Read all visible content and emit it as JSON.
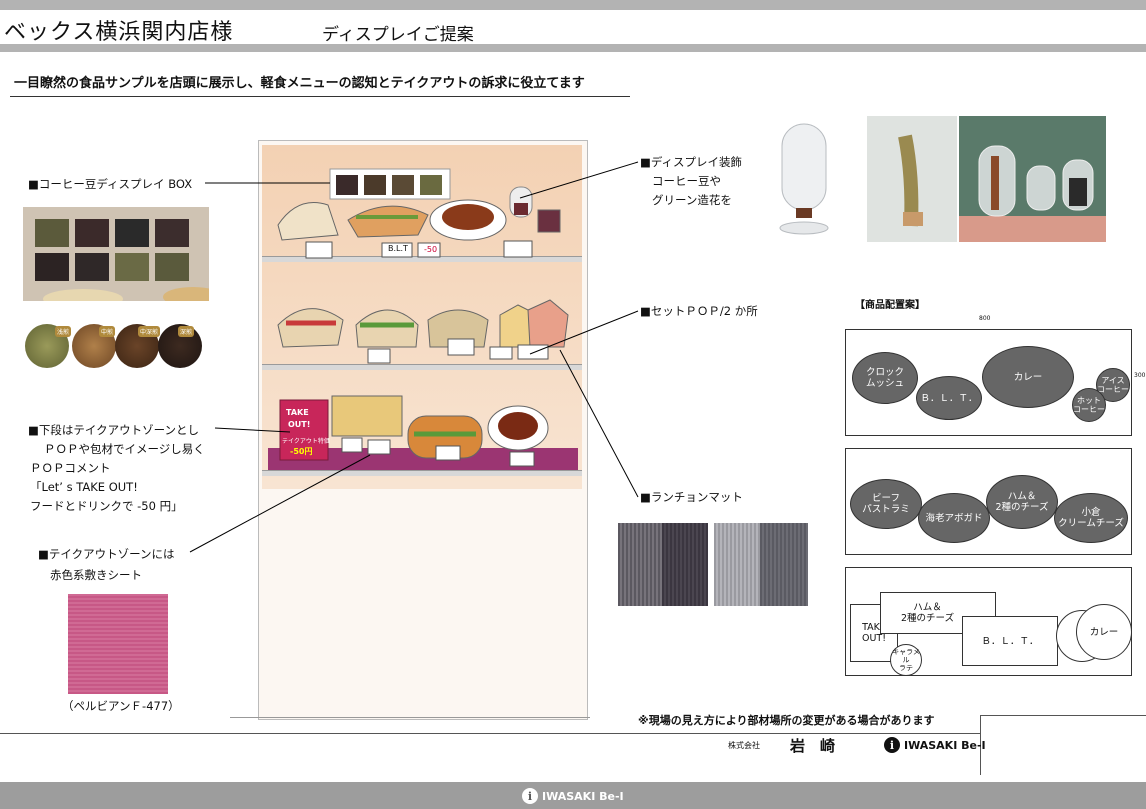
{
  "header": {
    "title": "ベックス横浜関内店様",
    "subtitle": "ディスプレイご提案"
  },
  "headline": "一目瞭然の食品サンプルを店頭に展示し、軽食メニューの認知とテイクアウトの訴求に役立てます",
  "left_labels": {
    "coffee_box": "■コーヒー豆ディスプレイ BOX",
    "lower_1": "■下段はテイクアウトゾーンとし",
    "lower_2": "ＰＯＰや包材でイメージし易く",
    "lower_3": "ＰＯＰコメント",
    "lower_4": "「Let’ s TAKE OUT!",
    "lower_5": "フードとドリンクで -50 円」",
    "zone_1": "■テイクアウトゾーンには",
    "zone_2": "赤色系敷きシート",
    "swatch_caption": "（ペルビアンＦ-477）"
  },
  "bean_badges": [
    "浅煎",
    "中煎",
    "中深煎",
    "深煎"
  ],
  "right_labels": {
    "deco_1": "■ディスプレイ装飾",
    "deco_2": "コーヒー豆や",
    "deco_3": "グリーン造花を",
    "set_pop": "■セットＰＯＰ/2 か所",
    "lunch_mat": "■ランチョンマット"
  },
  "pop_texts": {
    "blt": "B.L.T",
    "price": "-50",
    "take1": "TAKE",
    "take2": "OUT!",
    "takeaway_sub": "テイクアウト特価",
    "takeaway_price": "-50円"
  },
  "layout": {
    "title": "【商品配置案】",
    "width_label": "800",
    "height_label": "300",
    "box1": [
      "クロック\nムッシュ",
      "Ｂ．Ｌ．Ｔ．",
      "カレー",
      "アイス\nコーヒー",
      "ホット\nコーヒー"
    ],
    "box2": [
      "ビーフ\nパストラミ",
      "海老アボガド",
      "ハム＆\n2種のチーズ",
      "小倉\nクリームチーズ"
    ],
    "box3": [
      "TAKE\nOUT!",
      "ハム＆\n2種のチーズ",
      "Ｂ．Ｌ．Ｔ．",
      "カレー",
      "キャラメル\nラテ"
    ]
  },
  "note": "※現場の見え方により部材場所の変更がある場合があります",
  "footer": {
    "company_prefix": "株式会社",
    "company_name": "岩　崎",
    "logo_text": "IWASAKI Be-I",
    "logo_i": "i"
  },
  "colors": {
    "bar_gray": "#b3b3b3",
    "pill_gray": "#666666",
    "pink_sheet": "#c75886",
    "cabinet_peach": "#f3d1b3"
  }
}
